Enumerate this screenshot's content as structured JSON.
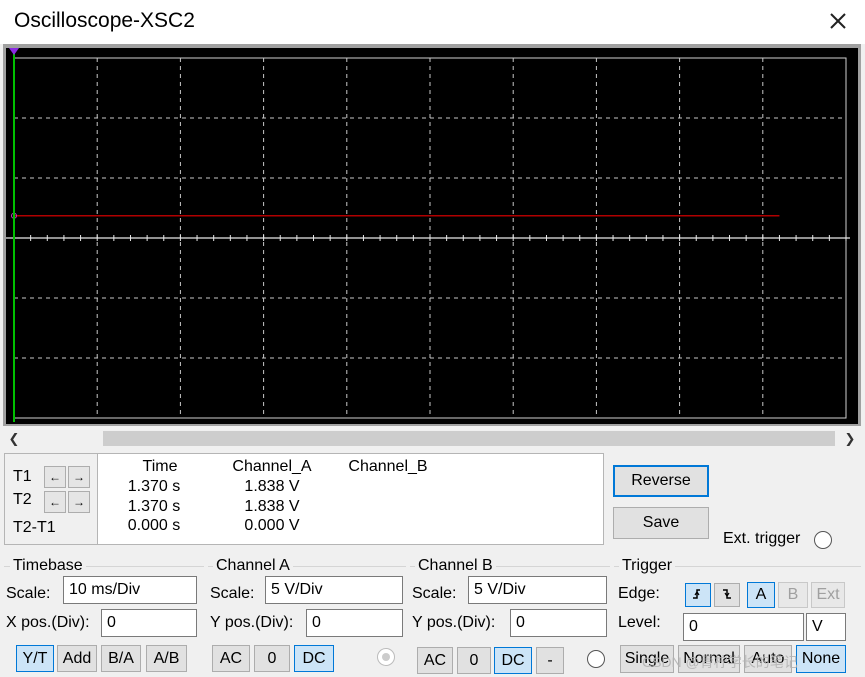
{
  "window": {
    "title": "Oscilloscope-XSC2"
  },
  "chart_data": {
    "type": "line",
    "title": "",
    "grid": true,
    "divisions": {
      "x": 10,
      "y": 6
    },
    "series": [
      {
        "trace": "channel_a",
        "y_div": 0.37,
        "x_start_div": 0.0,
        "x_end_div": 9.2,
        "color": "#b00000"
      }
    ],
    "cursors": [
      {
        "name": "T1",
        "x_div": 0.0,
        "color": "#00c000"
      }
    ]
  },
  "cursor_panel": {
    "t1": "T1",
    "t2": "T2",
    "t2_t1": "T2-T1",
    "left_arrow": "←",
    "right_arrow": "→"
  },
  "readout": {
    "headers": {
      "time": "Time",
      "channel_a": "Channel_A",
      "channel_b": "Channel_B"
    },
    "rows": [
      {
        "time": "1.370 s",
        "channel_a": "1.838 V",
        "channel_b": ""
      },
      {
        "time": "1.370 s",
        "channel_a": "1.838 V",
        "channel_b": ""
      },
      {
        "time": "0.000 s",
        "channel_a": "0.000 V",
        "channel_b": ""
      }
    ]
  },
  "buttons": {
    "reverse": "Reverse",
    "save": "Save"
  },
  "ext_trigger": {
    "label": "Ext. trigger"
  },
  "timebase": {
    "title": "Timebase",
    "scale_label": "Scale:",
    "scale_value": "10 ms/Div",
    "xpos_label": "X pos.(Div):",
    "xpos_value": "0",
    "modes": [
      "Y/T",
      "Add",
      "B/A",
      "A/B"
    ],
    "selected_mode": "Y/T"
  },
  "channel_a": {
    "title": "Channel A",
    "scale_label": "Scale:",
    "scale_value": "5  V/Div",
    "ypos_label": "Y pos.(Div):",
    "ypos_value": "0",
    "coupling": [
      "AC",
      "0",
      "DC"
    ],
    "selected": "DC"
  },
  "channel_b": {
    "title": "Channel B",
    "scale_label": "Scale:",
    "scale_value": "5  V/Div",
    "ypos_label": "Y pos.(Div):",
    "ypos_value": "0",
    "coupling": [
      "AC",
      "0",
      "DC",
      "-"
    ],
    "selected": "DC"
  },
  "trigger": {
    "title": "Trigger",
    "edge_label": "Edge:",
    "edge_rising_icon": "rising-edge-icon",
    "edge_falling_icon": "falling-edge-icon",
    "sources": [
      "A",
      "B",
      "Ext"
    ],
    "selected_source": "A",
    "level_label": "Level:",
    "level_value": "0",
    "level_unit": "V",
    "modes": [
      "Single",
      "Normal",
      "Auto",
      "None"
    ],
    "selected_mode": "None"
  },
  "watermark": "CSDN @青柠学长的笔记"
}
